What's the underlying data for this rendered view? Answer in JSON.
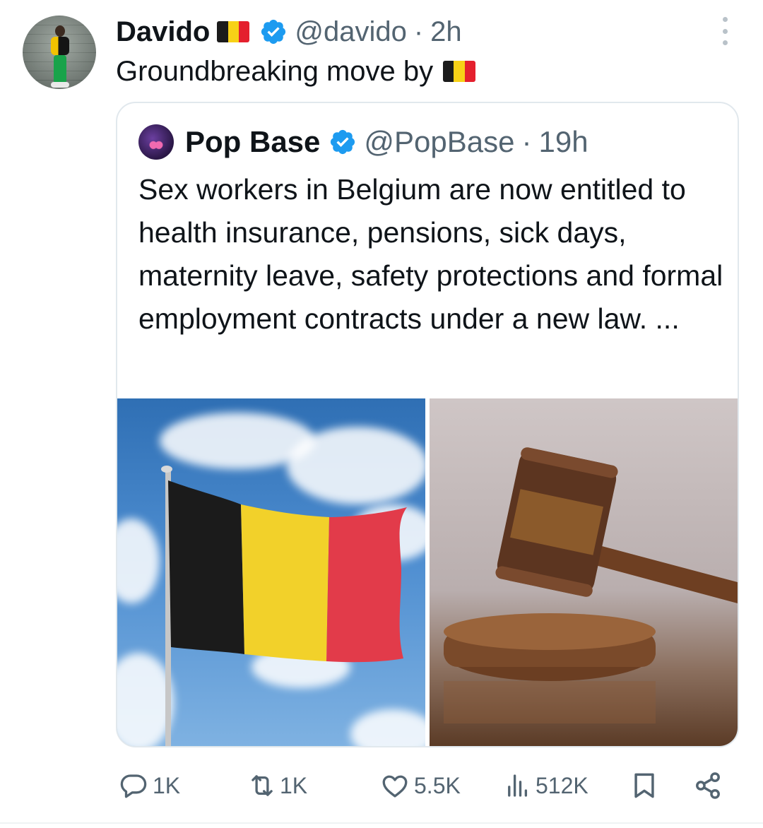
{
  "post": {
    "author_name": "Davido",
    "author_handle": "@davido",
    "time": "2h",
    "text": "Groundbreaking move by"
  },
  "quoted": {
    "author_name": "Pop Base",
    "author_handle": "@PopBase",
    "time": "19h",
    "text": "Sex workers in Belgium are now entitled to health insurance, pensions, sick days, maternity leave, safety protections and formal employment contracts under a new law. ..."
  },
  "actions": {
    "replies": "1K",
    "reposts": "1K",
    "likes": "5.5K",
    "views": "512K"
  },
  "colors": {
    "accent_blue": "#1d9bf0",
    "icon_gray": "#536471",
    "flag_black": "#1b1b1b",
    "flag_yellow": "#f7d117",
    "flag_red": "#e4202e"
  },
  "icons": {
    "reply": "reply-icon",
    "repost": "repost-icon",
    "like": "heart-icon",
    "views": "views-icon",
    "bookmark": "bookmark-icon",
    "share": "share-icon",
    "verified": "verified-badge-icon",
    "more": "more-icon",
    "flag": "belgium-flag-icon"
  }
}
